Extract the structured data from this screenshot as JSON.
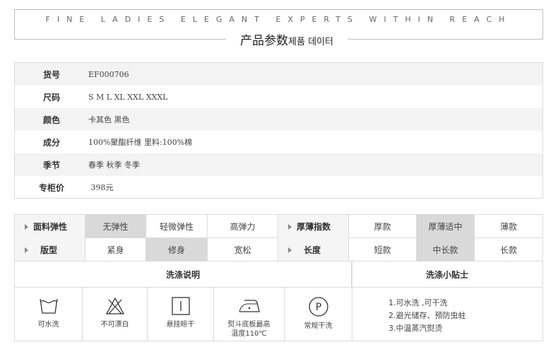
{
  "header": {
    "tagline": "FINE LADIES ELEGANT EXPERTS WITHIN REACH",
    "title_cn": "产品参数",
    "title_kr": "제품 데이터"
  },
  "params": [
    {
      "label": "货号",
      "value": "EF000706"
    },
    {
      "label": "尺码",
      "value": "S M L XL XXL XXXL"
    },
    {
      "label": "颜色",
      "value": "卡其色 黑色"
    },
    {
      "label": "成分",
      "value": "100%聚酯纤维  里料:100%棉"
    },
    {
      "label": "季节",
      "value": "春季 秋季 冬季"
    },
    {
      "label": "专柜价",
      "value": " 398元"
    }
  ],
  "attributes": {
    "row1": {
      "cat1": "面料弹性",
      "opts1": [
        "无弹性",
        "轻微弹性",
        "高弹力"
      ],
      "cat2": "厚薄指数",
      "opts2": [
        "厚款",
        "厚薄适中",
        "薄款"
      ]
    },
    "row2": {
      "cat1": "版型",
      "opts1": [
        "紧身",
        "修身",
        "宽松"
      ],
      "cat2": "长度",
      "opts2": [
        "短款",
        "中长款",
        "长款"
      ]
    }
  },
  "wash": {
    "instructions_title": "洗涤说明",
    "tips_title": "洗涤小贴士",
    "icons": [
      {
        "icon": "hand-wash-icon",
        "label": "可水洗"
      },
      {
        "icon": "no-bleach-icon",
        "label": "不可漂白"
      },
      {
        "icon": "hang-dry-icon",
        "label": "悬挂晾干"
      },
      {
        "icon": "iron-icon",
        "label": "熨斗底板最高",
        "label2": "温度110℃"
      },
      {
        "icon": "dry-clean-icon",
        "label": "常规干洗"
      }
    ],
    "tips": [
      "1.可水洗 ,可干洗",
      "2.避光储存、预防虫蛀",
      "3.中温蒸汽熨烫"
    ]
  }
}
